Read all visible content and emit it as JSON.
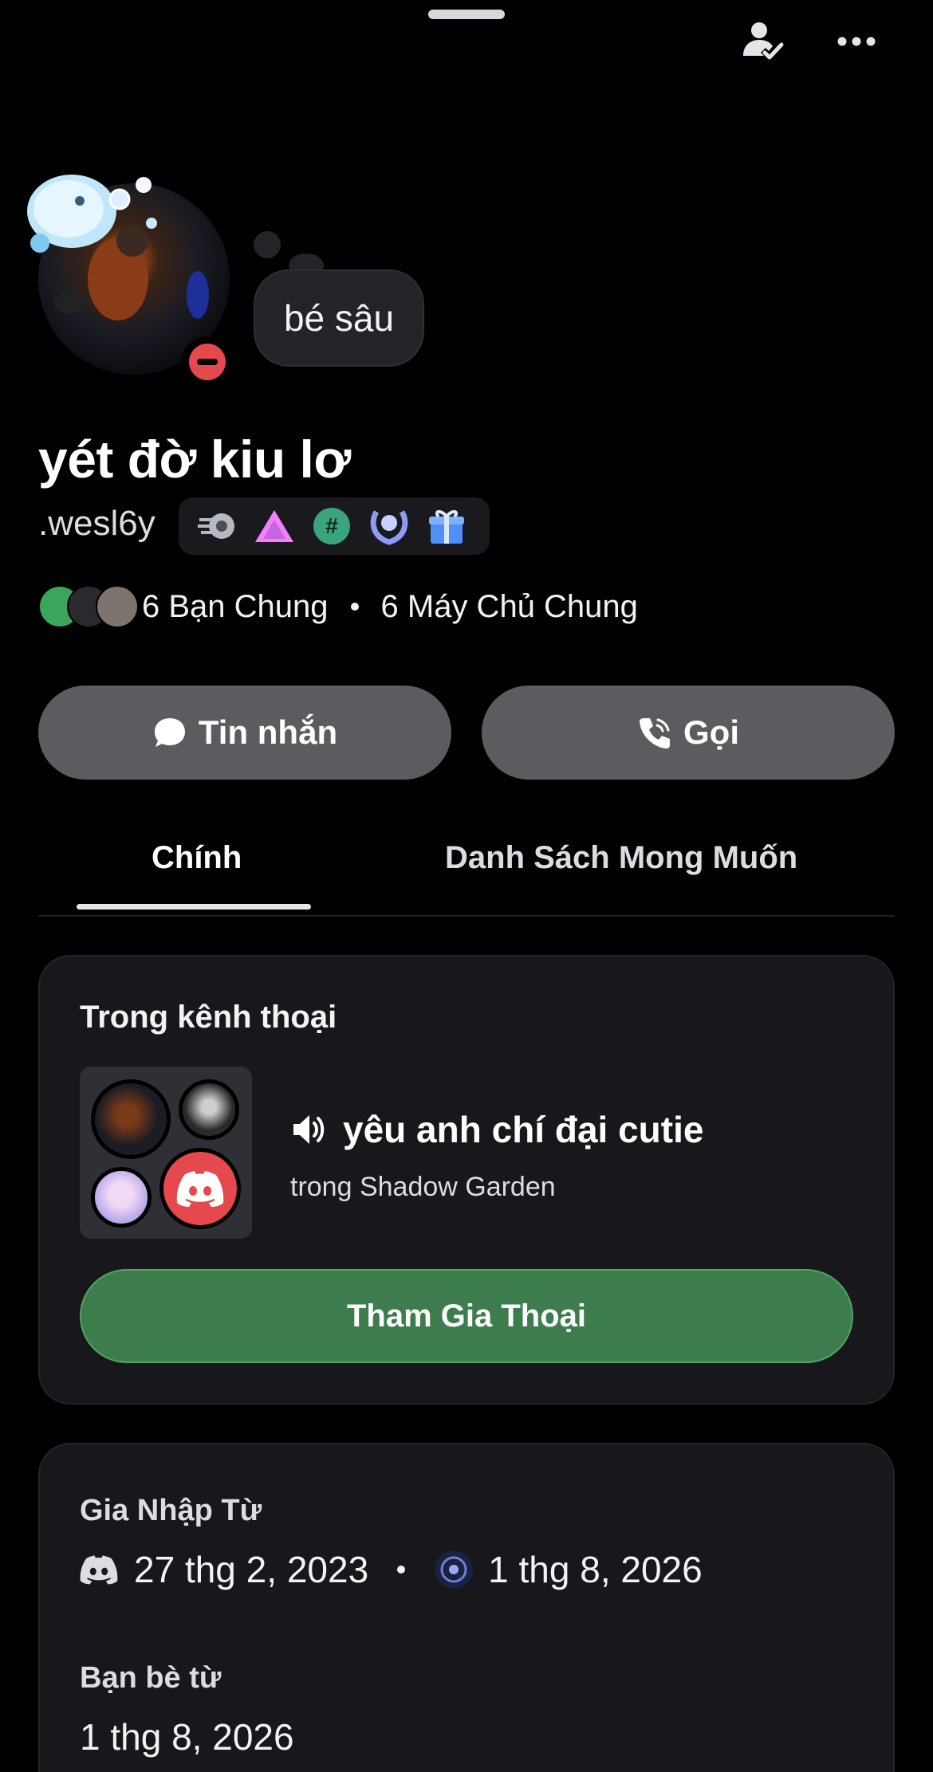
{
  "header": {
    "friend_status_icon": "user-check-icon",
    "more_icon": "ellipsis-icon"
  },
  "profile": {
    "note": "bé sâu",
    "display_name": "yét đờ kiu lơ",
    "username": ".wesl6y",
    "status": "dnd",
    "badges": [
      "nitro-badge",
      "boost-badge",
      "hashtag-badge",
      "quest-badge",
      "gift-badge"
    ]
  },
  "mutuals": {
    "friends": "6 Bạn Chung",
    "servers": "6 Máy Chủ Chung"
  },
  "actions": {
    "message_label": "Tin nhắn",
    "call_label": "Gọi"
  },
  "tabs": [
    {
      "label": "Chính",
      "active": true
    },
    {
      "label": "Danh Sách Mong Muốn",
      "active": false
    }
  ],
  "voice": {
    "title": "Trong kênh thoại",
    "channel": "yêu anh chí đại cutie",
    "server": "trong Shadow Garden",
    "join_label": "Tham Gia Thoại"
  },
  "member_since": {
    "title": "Gia Nhập Từ",
    "discord_date": "27 thg 2, 2023",
    "server_date": "1 thg 8, 2026",
    "friends_title": "Bạn bè từ",
    "friends_date": "1 thg 8, 2026"
  },
  "colors": {
    "background": "#000000",
    "card": "#18181c",
    "button": "#5c5c60",
    "join_green": "#3d7d4d",
    "dnd_red": "#e5484d"
  }
}
